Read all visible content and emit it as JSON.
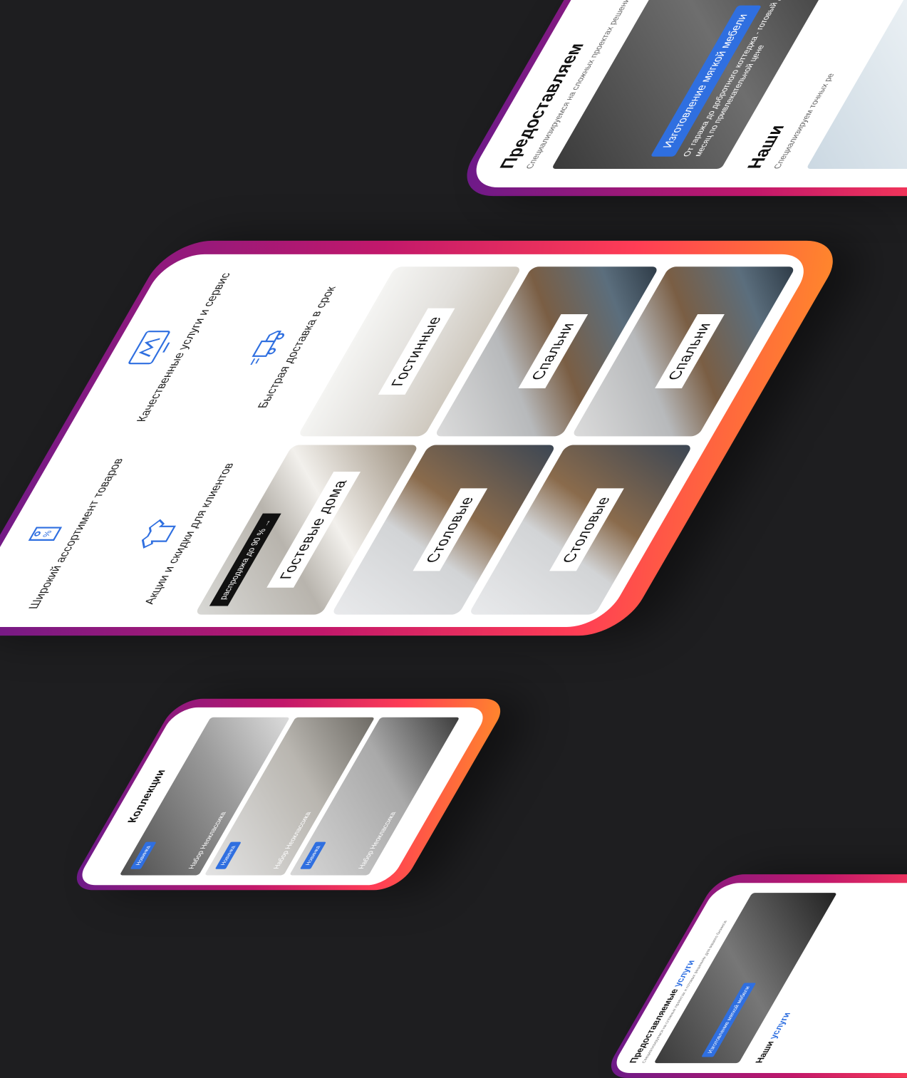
{
  "main_phone": {
    "features": [
      {
        "label": "Качественные услуги и сервис",
        "icon": "monitor-logo-icon"
      },
      {
        "label": "Широкий ассортимент товаров",
        "icon": "price-tag-icon"
      },
      {
        "label": "Быстрая доставка в срок",
        "icon": "delivery-truck-icon"
      },
      {
        "label": "Акции и скидки для клиентов",
        "icon": "tshirt-icon"
      }
    ],
    "tiles": [
      {
        "label": "Гостевые дома",
        "sale": "распродажа до 90 % →"
      },
      {
        "label": "Гостинные"
      },
      {
        "label": "Столовые"
      },
      {
        "label": "Спальни"
      },
      {
        "label": "Столовые"
      },
      {
        "label": "Спальни"
      }
    ]
  },
  "top_phone": {
    "title": "Предоставляем",
    "subtitle": "Специализируемся на сложных проектах решениях для вашего бизнеса",
    "banner_button": "Изготовление мягкой мебели",
    "banner_text": "От гаража до добротного коттеджа - готовый дом меньше чем за месяц по привлекательной цене",
    "section2_title": "Наши",
    "section2_sub": "Специализируем точных ре"
  },
  "collections_phone": {
    "title": "Коллекции",
    "cards": [
      {
        "badge": "Новинка",
        "caption": "Набор Неоклассика"
      },
      {
        "badge": "Новинка",
        "caption": "Набор Неоклассика"
      },
      {
        "badge": "Новинка",
        "caption": "Набор Неоклассика"
      }
    ]
  },
  "br_phone": {
    "title_main": "Предоставляемые",
    "title_accent": "услуги",
    "subtitle": "Специализируемся на сложных проектах и готовых решениях для вашего бизнеса",
    "banner_button": "Изготовление мягкой мебели",
    "section2_main": "Наши",
    "section2_accent": "услуги"
  },
  "colors": {
    "accent": "#2f6fe0",
    "background": "#1e1e20",
    "frame_start": "#6a1a8a",
    "frame_end": "#ff8a2a"
  }
}
